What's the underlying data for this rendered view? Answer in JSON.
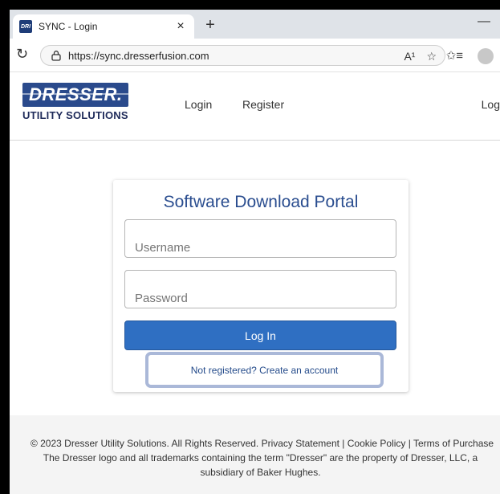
{
  "browser": {
    "tab_title": "SYNC - Login",
    "favicon_text": "DRI",
    "url": "https://sync.dresserfusion.com",
    "read_aloud_label": "A¹",
    "icons": [
      "reload-icon",
      "lock-icon",
      "read-aloud-icon",
      "favorite-star-icon",
      "favorites-icon",
      "profile-icon"
    ]
  },
  "header": {
    "logo_top": "DRESSER.",
    "logo_bottom": "UTILITY SOLUTIONS",
    "nav_login": "Login",
    "nav_register": "Register",
    "nav_right": "Log"
  },
  "login": {
    "title": "Software Download Portal",
    "username_placeholder": "Username",
    "password_placeholder": "Password",
    "button": "Log In",
    "register_link": "Not registered? Create an account"
  },
  "footer": {
    "line1": "© 2023 Dresser Utility Solutions. All Rights Reserved. Privacy Statement | Cookie Policy | Terms of Purchase",
    "line2": "The Dresser logo and all trademarks containing the term \"Dresser\" are the property of Dresser, LLC, a",
    "line3": "subsidiary of Baker Hughes."
  },
  "colors": {
    "brand_blue": "#2a4a8c",
    "button_blue": "#2f6fc2",
    "title_blue": "#2a4d8f"
  }
}
